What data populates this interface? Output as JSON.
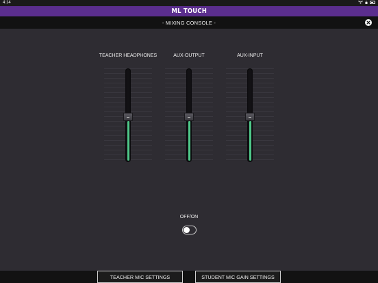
{
  "status_bar": {
    "time": "4:14",
    "icons": [
      "wifi-icon",
      "lock-icon",
      "battery-icon"
    ]
  },
  "app": {
    "title": "ML TOUCH",
    "accent_color": "#5b2e8e"
  },
  "sub_header": {
    "title": "- MIXING CONSOLE -",
    "close_icon": "close-icon"
  },
  "channels": [
    {
      "label": "TEACHER HEADPHONES",
      "level": 0.48
    },
    {
      "label": "AUX-OUTPUT",
      "level": 0.48
    },
    {
      "label": "AUX-INPUT",
      "level": 0.48
    }
  ],
  "fill_color": "#4ec889",
  "toggle": {
    "label": "OFF/ON",
    "state": "off"
  },
  "bottom_buttons": {
    "teacher_mic": "TEACHER MIC SETTINGS",
    "student_mic": "STUDENT MIC GAIN SETTINGS"
  }
}
